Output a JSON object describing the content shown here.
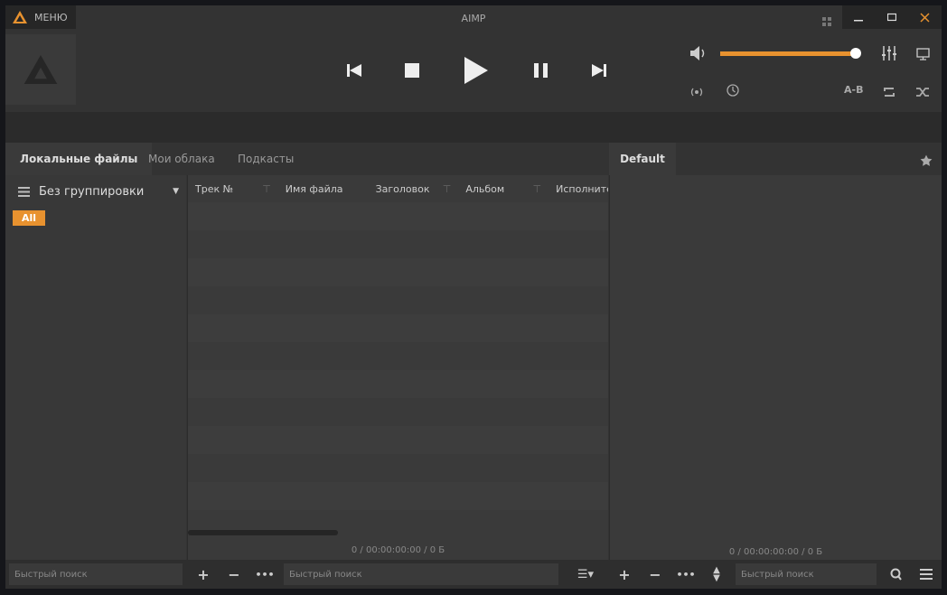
{
  "app": {
    "title": "AIMP",
    "menu_label": "МЕНЮ",
    "accent": "#e8922f"
  },
  "window_controls": [
    "minimize",
    "maximize",
    "close"
  ],
  "player": {
    "volume_percent": 100,
    "ab_label": "A-B"
  },
  "tabs": [
    {
      "label": "Локальные файлы",
      "active": true
    },
    {
      "label": "Мои облака"
    },
    {
      "label": "Подкасты"
    }
  ],
  "library": {
    "grouping": "Без группировки",
    "filter_badge": "All",
    "columns": [
      "Трек №",
      "Имя файла",
      "Заголовок",
      "Альбом",
      "Исполните"
    ],
    "status": "0 / 00:00:00:00 / 0 Б",
    "search_placeholder": "Быстрый поиск",
    "side_search_placeholder": "Быстрый поиск"
  },
  "playlist": {
    "tab": "Default",
    "status": "0 / 00:00:00:00 / 0 Б",
    "search_placeholder": "Быстрый поиск"
  }
}
